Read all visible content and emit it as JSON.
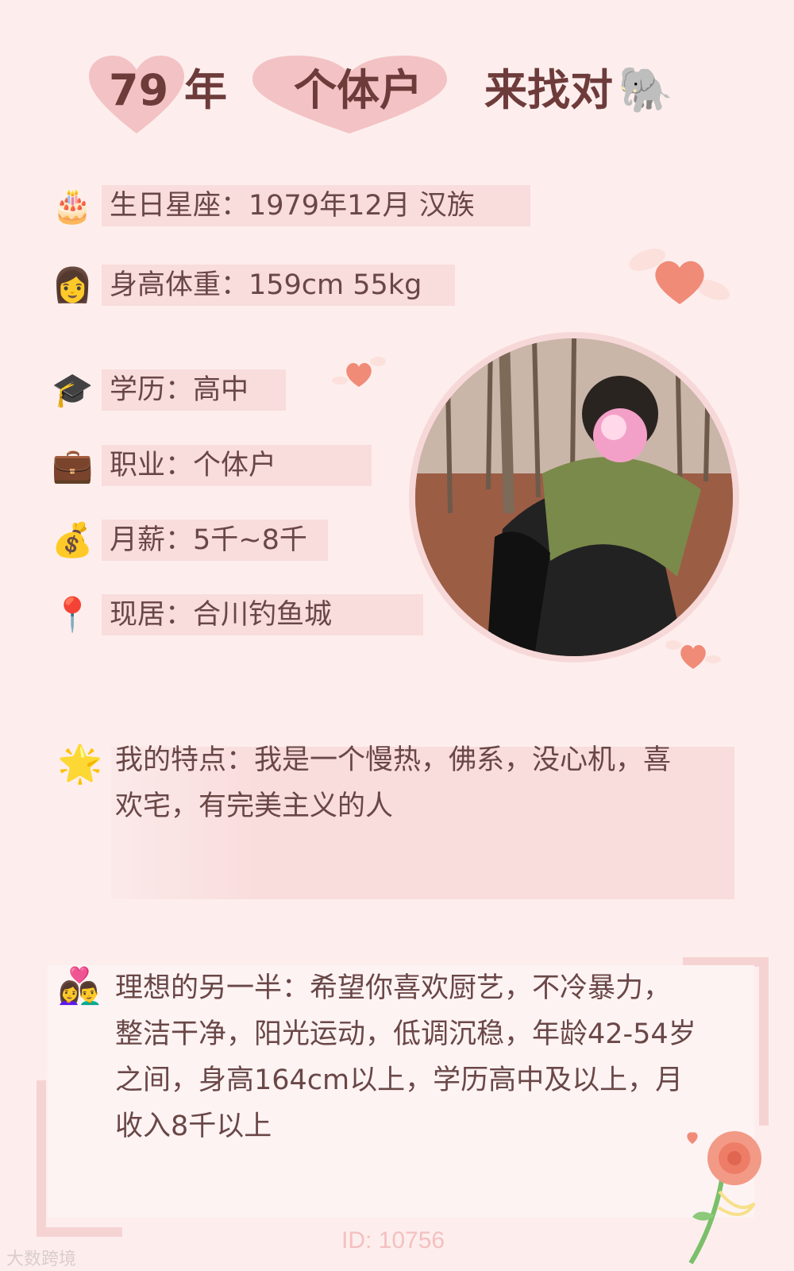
{
  "header": {
    "year": "79",
    "year_unit": "年",
    "occupation": "个体户",
    "seek": "来找对",
    "elephant_icon": "🐘"
  },
  "info": [
    {
      "icon": "cake-icon",
      "glyph": "🎂",
      "text": "生日星座：1979年12月 汉族"
    },
    {
      "icon": "woman-icon",
      "glyph": "👩",
      "text": "身高体重：159cm 55kg"
    },
    {
      "icon": "graduation-cap-icon",
      "glyph": "🎓",
      "text": "学历：高中"
    },
    {
      "icon": "briefcase-icon",
      "glyph": "💼",
      "text": "职业：个体户"
    },
    {
      "icon": "money-bag-icon",
      "glyph": "💰",
      "text": "月薪：5千~8千"
    },
    {
      "icon": "location-pin-icon",
      "glyph": "📍",
      "text": "现居：合川钓鱼城"
    }
  ],
  "traits": {
    "icon": "star-icon",
    "glyph": "🌟",
    "line1": "我的特点：我是一个慢热，佛系，没心机，喜",
    "line2": "欢宅，有完美主义的人"
  },
  "ideal": {
    "icon": "couple-icon",
    "glyph": "👩‍❤️‍👨",
    "line1": "理想的另一半：希望你喜欢厨艺，不冷暴力，",
    "line2": "整洁干净，阳光运动，低调沉稳，年龄42-54岁",
    "line3": "之间，身高164cm以上，学历高中及以上，月",
    "line4": "收入8千以上"
  },
  "footer": {
    "id_text": "ID: 10756",
    "watermark": "大数跨境"
  },
  "colors": {
    "background": "#fdeeed",
    "bar": "#f9dcdc",
    "heart": "#f3c2c4",
    "accent_heart": "#f08b78",
    "text": "#6a4747"
  }
}
